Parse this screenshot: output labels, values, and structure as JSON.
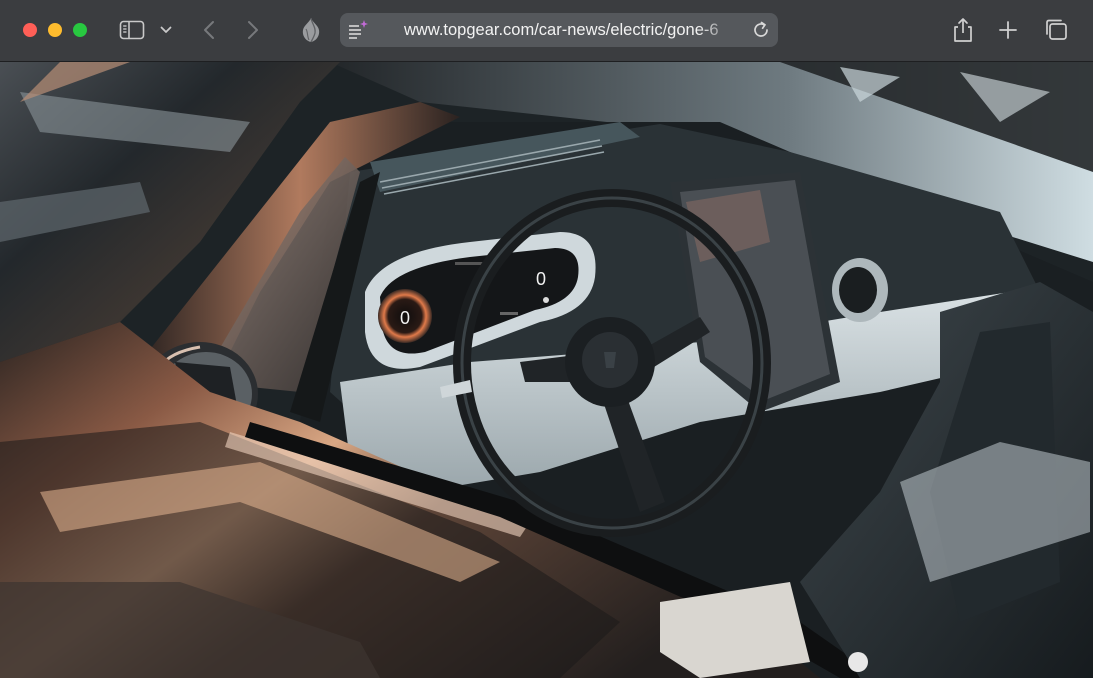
{
  "browser": {
    "url": "www.topgear.com/car-news/electric/gone-6",
    "buttons": {
      "close": "close-window",
      "minimize": "minimize-window",
      "zoom": "zoom-window",
      "sidebar": "sidebar-icon",
      "tab_overview_menu": "chevron-down-icon",
      "back": "chevron-left-icon",
      "forward": "chevron-right-icon",
      "privacy_report": "privacy-shield-icon",
      "reader": "reader-icon",
      "reload": "reload-icon",
      "share": "share-icon",
      "new_tab": "plus-icon",
      "tab_overview": "tabs-icon"
    },
    "colors": {
      "toolbar": "#3b3d40",
      "address_bar": "#55585c",
      "close": "#ff5f57",
      "minimize": "#febc2e",
      "zoom": "#28c840"
    }
  },
  "page": {
    "image": {
      "subject": "car-interior-photo",
      "dash_left_readout": "0",
      "dash_right_readout": "0"
    }
  }
}
